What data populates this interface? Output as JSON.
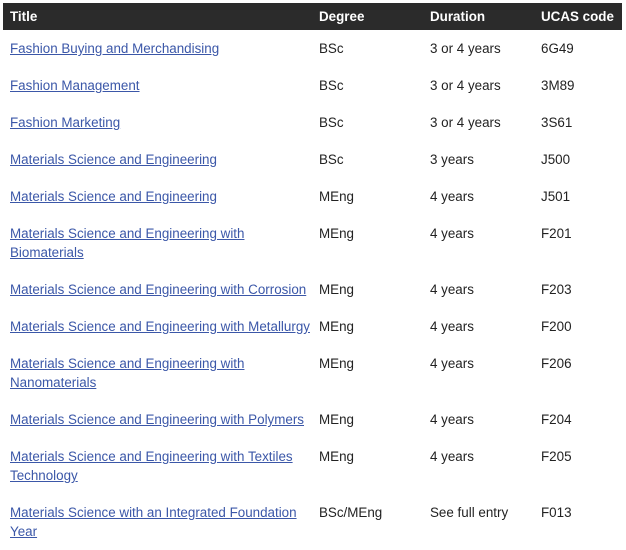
{
  "table": {
    "headers": {
      "title": "Title",
      "degree": "Degree",
      "duration": "Duration",
      "ucas": "UCAS code"
    },
    "rows": [
      {
        "title": "Fashion Buying and Merchandising",
        "degree": "BSc",
        "duration": "3 or 4 years",
        "ucas": "6G49"
      },
      {
        "title": "Fashion Management",
        "degree": "BSc",
        "duration": "3 or 4 years",
        "ucas": "3M89"
      },
      {
        "title": "Fashion Marketing",
        "degree": "BSc",
        "duration": "3 or 4 years",
        "ucas": "3S61"
      },
      {
        "title": "Materials Science and Engineering",
        "degree": "BSc",
        "duration": "3 years",
        "ucas": "J500"
      },
      {
        "title": "Materials Science and Engineering",
        "degree": "MEng",
        "duration": "4 years",
        "ucas": "J501"
      },
      {
        "title": "Materials Science and Engineering with Biomaterials",
        "degree": "MEng",
        "duration": "4 years",
        "ucas": "F201"
      },
      {
        "title": "Materials Science and Engineering with Corrosion",
        "degree": "MEng",
        "duration": "4 years",
        "ucas": "F203"
      },
      {
        "title": "Materials Science and Engineering with Metallurgy",
        "degree": "MEng",
        "duration": "4 years",
        "ucas": "F200"
      },
      {
        "title": "Materials Science and Engineering with Nanomaterials",
        "degree": "MEng",
        "duration": "4 years",
        "ucas": "F206"
      },
      {
        "title": "Materials Science and Engineering with Polymers",
        "degree": "MEng",
        "duration": "4 years",
        "ucas": "F204"
      },
      {
        "title": "Materials Science and Engineering with Textiles Technology",
        "degree": "MEng",
        "duration": "4 years",
        "ucas": "F205"
      },
      {
        "title": "Materials Science with an Integrated Foundation Year",
        "degree": "BSc/MEng",
        "duration": "See full entry",
        "ucas": "F013"
      }
    ]
  },
  "colors": {
    "header_bg": "#2b2b2b",
    "header_text": "#ffffff",
    "link": "#3b57a8",
    "body_text": "#222222"
  }
}
